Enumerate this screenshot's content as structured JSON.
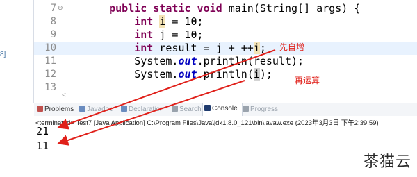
{
  "left_fragment": "8]",
  "editor": {
    "lines": [
      {
        "num": "7",
        "marker": "⊖",
        "tokens": [
          {
            "t": "    "
          },
          {
            "t": "public static void",
            "c": "kw"
          },
          {
            "t": " main(String[] args) {"
          }
        ]
      },
      {
        "num": "8",
        "tokens": [
          {
            "t": "        "
          },
          {
            "t": "int",
            "c": "kw"
          },
          {
            "t": " "
          },
          {
            "t": "i",
            "c": "hlw"
          },
          {
            "t": " = 10;"
          }
        ]
      },
      {
        "num": "9",
        "tokens": [
          {
            "t": "        "
          },
          {
            "t": "int",
            "c": "kw"
          },
          {
            "t": " j = 10;"
          }
        ]
      },
      {
        "num": "10",
        "current": true,
        "tokens": [
          {
            "t": "        "
          },
          {
            "t": "int",
            "c": "kw"
          },
          {
            "t": " result = j + ++"
          },
          {
            "t": "i",
            "c": "hlw"
          },
          {
            "t": ";"
          }
        ]
      },
      {
        "num": "11",
        "tokens": [
          {
            "t": "        System."
          },
          {
            "t": "out",
            "c": "fld"
          },
          {
            "t": ".println(result);"
          }
        ]
      },
      {
        "num": "12",
        "tokens": [
          {
            "t": "        System."
          },
          {
            "t": "out",
            "c": "fld"
          },
          {
            "t": ".println("
          },
          {
            "t": "i",
            "c": "hl"
          },
          {
            "t": ");"
          }
        ]
      },
      {
        "num": "13",
        "tokens": []
      }
    ]
  },
  "annotations": {
    "pre_increment": "先自增",
    "then_compute": "再运算"
  },
  "tabs": [
    {
      "label": "Problems",
      "icon_color": "#c0504d",
      "dim": false,
      "active": false
    },
    {
      "label": "Javadoc",
      "icon_color": "#6a8cbf",
      "dim": true,
      "active": false
    },
    {
      "label": "Declaration",
      "icon_color": "#6a8cbf",
      "dim": true,
      "active": false
    },
    {
      "label": "Search",
      "icon_color": "#9aa3ad",
      "dim": true,
      "active": false
    },
    {
      "label": "Console",
      "icon_color": "#1f3b6e",
      "dim": false,
      "active": true
    },
    {
      "label": "Progress",
      "icon_color": "#9aa3ad",
      "dim": true,
      "active": false
    }
  ],
  "console": {
    "terminated_line": "<terminated> Test7 [Java Application] C:\\Program Files\\Java\\jdk1.8.0_121\\bin\\javaw.exe  (2023年3月3日 下午2:39:59)",
    "output": [
      "21",
      "11"
    ]
  },
  "watermark": "茶猫云",
  "colors": {
    "keyword": "#7f0055",
    "field": "#0000c0",
    "annotation": "#e0201a",
    "current_line": "#e8f2fe"
  }
}
